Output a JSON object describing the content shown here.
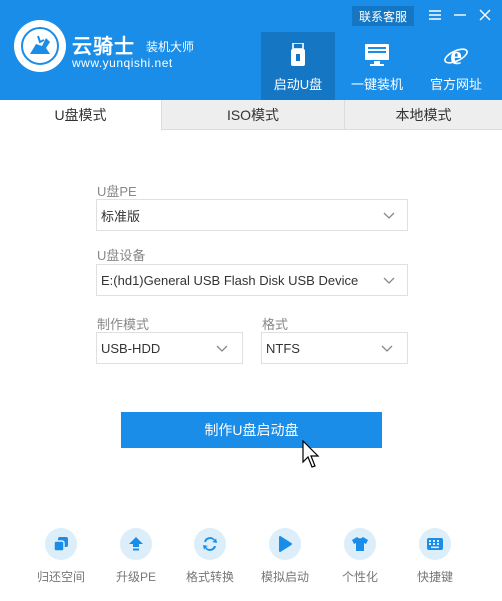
{
  "header": {
    "brand_name": "云骑士",
    "brand_sub": "装机大师",
    "brand_url": "www.yunqishi.net",
    "service_label": "联系客服",
    "nav": [
      {
        "label": "启动U盘",
        "icon": "usb-icon",
        "active": true
      },
      {
        "label": "一键装机",
        "icon": "monitor-icon",
        "active": false
      },
      {
        "label": "官方网址",
        "icon": "ie-icon",
        "active": false
      }
    ]
  },
  "tabs": [
    {
      "label": "U盘模式",
      "active": true
    },
    {
      "label": "ISO模式",
      "active": false
    },
    {
      "label": "本地模式",
      "active": false
    }
  ],
  "form": {
    "pe_label": "U盘PE",
    "pe_value": "标准版",
    "device_label": "U盘设备",
    "device_value": "E:(hd1)General USB Flash Disk USB Device",
    "mode_label": "制作模式",
    "mode_value": "USB-HDD",
    "format_label": "格式",
    "format_value": "NTFS"
  },
  "make_button_label": "制作U盘启动盘",
  "tools": [
    {
      "label": "归还空间",
      "icon": "restore-space-icon"
    },
    {
      "label": "升级PE",
      "icon": "upgrade-icon"
    },
    {
      "label": "格式转换",
      "icon": "convert-icon"
    },
    {
      "label": "模拟启动",
      "icon": "play-icon"
    },
    {
      "label": "个性化",
      "icon": "tshirt-icon"
    },
    {
      "label": "快捷键",
      "icon": "keyboard-icon"
    }
  ],
  "colors": {
    "primary": "#1a8de8",
    "primary_dark": "#1576c4",
    "tool_bg": "#dceefa"
  }
}
